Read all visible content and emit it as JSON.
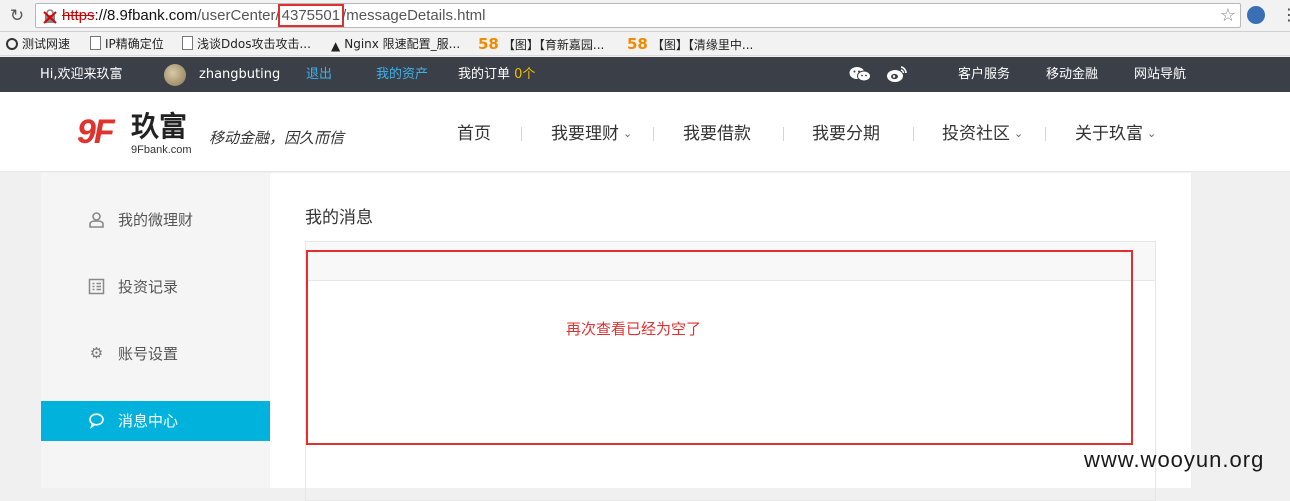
{
  "browser": {
    "url_scheme": "https",
    "url_sep": "://",
    "url_host": "8.9fbank.com",
    "url_path1": "/userCenter/",
    "url_id": "4375501",
    "url_path2": "/messageDetails.html",
    "bookmarks": [
      {
        "label": "测试网速",
        "icon": "eye-icon"
      },
      {
        "label": "IP精确定位",
        "icon": "page-icon"
      },
      {
        "label": "浅谈Ddos攻击攻击...",
        "icon": "page-icon"
      },
      {
        "label": "Nginx 限速配置_服...",
        "icon": "penguin-icon"
      },
      {
        "label": "【图】【育新嘉园...",
        "icon": "58-icon",
        "icon_text": "58"
      },
      {
        "label": "【图】【清缘里中...",
        "icon": "58-icon",
        "icon_text": "58"
      }
    ]
  },
  "topbar": {
    "welcome": "Hi,欢迎来玖富",
    "username": "zhangbuting",
    "logout": "退出",
    "my_assets": "我的资产",
    "my_orders": "我的订单",
    "order_count": "0个",
    "customer_service": "客户服务",
    "mobile_finance": "移动金融",
    "site_nav": "网站导航"
  },
  "header": {
    "logo_mark": "9F",
    "logo_name": "玖富",
    "logo_domain": "9Fbank.com",
    "slogan": "移动金融，因久而信",
    "nav": [
      {
        "label": "首页",
        "dropdown": false
      },
      {
        "label": "我要理财",
        "dropdown": true
      },
      {
        "label": "我要借款",
        "dropdown": false
      },
      {
        "label": "我要分期",
        "dropdown": false
      },
      {
        "label": "投资社区",
        "dropdown": true
      },
      {
        "label": "关于玖富",
        "dropdown": true
      }
    ],
    "caret": "⌄"
  },
  "sidebar": {
    "items": [
      {
        "label": "我的微理财",
        "icon": "user-icon",
        "active": false
      },
      {
        "label": "投资记录",
        "icon": "list-icon",
        "active": false
      },
      {
        "label": "账号设置",
        "icon": "gear-icon",
        "active": false
      },
      {
        "label": "消息中心",
        "icon": "chat-bubble-icon",
        "active": true
      }
    ]
  },
  "main": {
    "title": "我的消息",
    "annotation": "再次查看已经为空了"
  },
  "watermark": "www.wooyun.org",
  "colors": {
    "topbar_bg": "#3a3f48",
    "link": "#3fb2ea",
    "active_sidebar": "#00b2dc",
    "brand_red": "#e0332e",
    "annotation_red": "#e03030"
  }
}
